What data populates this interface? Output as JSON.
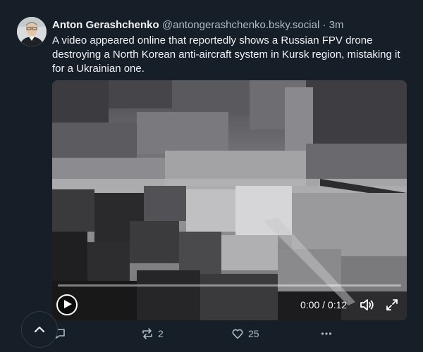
{
  "post": {
    "author_name": "Anton Gerashchenko",
    "author_handle": "@antongerashchenko.bsky.social",
    "separator": "·",
    "time": "3m",
    "text": "A video appeared online that reportedly shows a Russian FPV drone destroying a North Korean anti-aircraft system in Kursk region, mistaking it for a Ukrainian one."
  },
  "video": {
    "time_readout": "0:00 / 0:12",
    "progress": 0
  },
  "actions": {
    "reply_count": "",
    "repost_count": "2",
    "like_count": "25"
  },
  "icons": {
    "avatar": "avatar",
    "play": "play-icon",
    "volume": "volume-icon",
    "fullscreen": "fullscreen-icon",
    "reply": "reply-icon",
    "repost": "repost-icon",
    "like": "heart-icon",
    "more": "more-icon",
    "scroll_top": "chevron-up-icon"
  },
  "colors": {
    "background": "#161e27",
    "text": "#f1f3f5",
    "muted": "#aebbc9"
  }
}
